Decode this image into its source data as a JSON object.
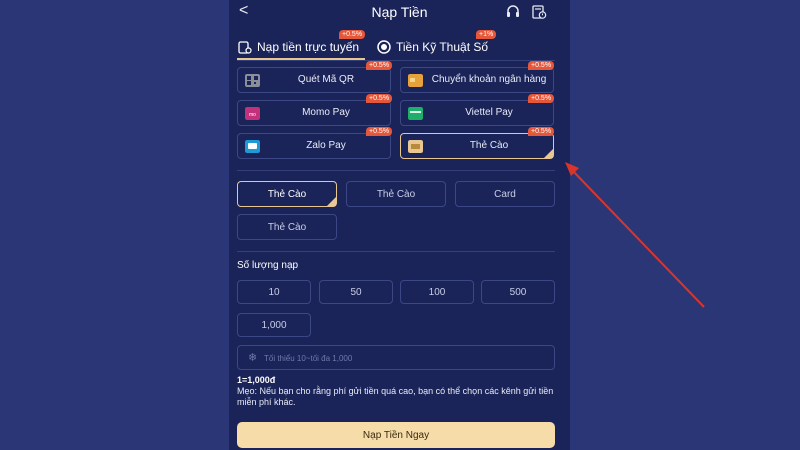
{
  "header": {
    "back_glyph": "<",
    "title": "Nạp Tiền",
    "support_icon": "headset-icon",
    "history_icon": "history-icon"
  },
  "tabs": [
    {
      "label": "Nạp tiền trực tuyến",
      "badge": "+0.5%",
      "icon": "wallet-icon",
      "active": true
    },
    {
      "label": "Tiền Kỹ Thuật Số",
      "badge": "+1%",
      "icon": "coin-icon",
      "active": false
    }
  ],
  "methods": [
    {
      "label": "Quét Mã QR",
      "badge": "+0.5%",
      "icon": "qr-icon",
      "color": "#8a8f99",
      "active": false
    },
    {
      "label": "Chuyển khoản ngân hàng",
      "badge": "+0.5%",
      "icon": "bank-card-icon",
      "color": "#e8a23c",
      "active": false
    },
    {
      "label": "Momo Pay",
      "badge": "+0.5%",
      "icon": "momo-icon",
      "color": "#c2317a",
      "active": false
    },
    {
      "label": "Viettel Pay",
      "badge": "+0.5%",
      "icon": "viettel-icon",
      "color": "#1fae6b",
      "active": false
    },
    {
      "label": "Zalo Pay",
      "badge": "+0.5%",
      "icon": "zalo-icon",
      "color": "#1f9ad6",
      "active": false
    },
    {
      "label": "Thẻ Cào",
      "badge": "+0.5%",
      "icon": "scratch-card-icon",
      "color": "#e8c792",
      "active": true
    }
  ],
  "channels": [
    {
      "label": "Thẻ Cào",
      "active": true
    },
    {
      "label": "Thẻ Cào",
      "active": false
    },
    {
      "label": "Card",
      "active": false
    },
    {
      "label": "Thẻ Cào",
      "active": false
    }
  ],
  "amount": {
    "section_title": "Số lượng nạp",
    "presets": [
      "10",
      "50",
      "100",
      "500",
      "1,000"
    ],
    "placeholder": "Tối thiểu 10~tối đa 1,000"
  },
  "rate": "1=1,000đ",
  "tip": "Mẹo: Nếu bạn cho rằng phí gửi tiền quá cao, bạn có thể chọn các kênh gửi tiền miễn phí khác.",
  "submit_label": "Nạp Tiền Ngay",
  "colors": {
    "accent": "#e8c792",
    "badge": "#e5573a",
    "background": "#2b3676",
    "panel": "#1b2459",
    "arrow": "#d9352b"
  }
}
